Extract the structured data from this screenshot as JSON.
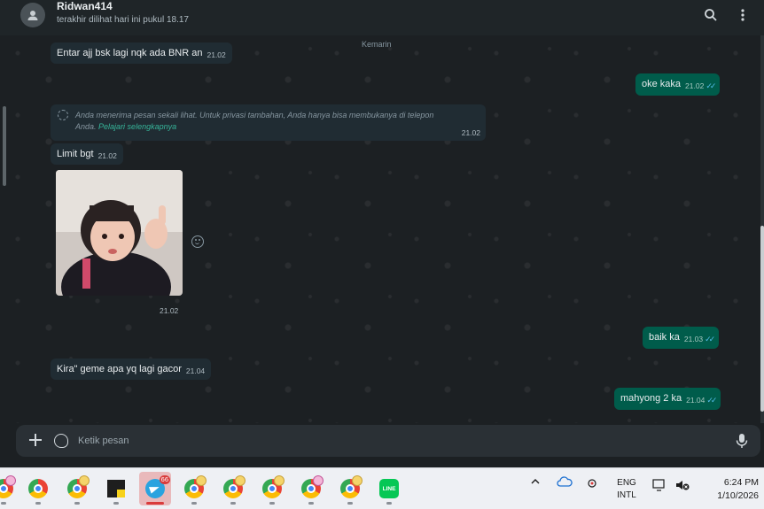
{
  "header": {
    "contact_name": "Ridwan414",
    "last_seen": "terakhir dilihat hari ini pukul 18.17"
  },
  "chat": {
    "date_separator": "Kemarin",
    "messages": [
      {
        "direction": "in",
        "text": "Entar ajj bsk lagi nqk ada BNR an",
        "time": "21.02"
      },
      {
        "direction": "out",
        "text": "oke kaka",
        "time": "21.02",
        "read": true
      },
      {
        "direction": "notice",
        "text": "Anda menerima pesan sekali lihat. Untuk privasi tambahan, Anda hanya bisa membukanya di telepon Anda.",
        "link": "Pelajari selengkapnya",
        "time": "21.02"
      },
      {
        "direction": "in",
        "text": "Limit bgt",
        "time": "21.02"
      },
      {
        "direction": "in",
        "type": "image",
        "time": "21.02"
      },
      {
        "direction": "out",
        "text": "baik ka",
        "time": "21.03",
        "read": true
      },
      {
        "direction": "in",
        "text": "Kira\" geme apa yq lagi gacor",
        "time": "21.04"
      },
      {
        "direction": "out",
        "text": "mahyong 2 ka",
        "time": "21.04",
        "read": true
      }
    ],
    "read_ticks": "✓✓"
  },
  "composer": {
    "placeholder": "Ketik pesan"
  },
  "taskbar": {
    "telegram_badge": "66",
    "line_label": "LINE",
    "lang_top": "ENG",
    "lang_bottom": "INTL",
    "time": "6:24 PM",
    "date": "1/10/2026"
  },
  "colors": {
    "incoming_bubble": "#202c33",
    "outgoing_bubble": "#005c4b",
    "read_tick": "#53bdeb",
    "link": "#36b59a"
  }
}
